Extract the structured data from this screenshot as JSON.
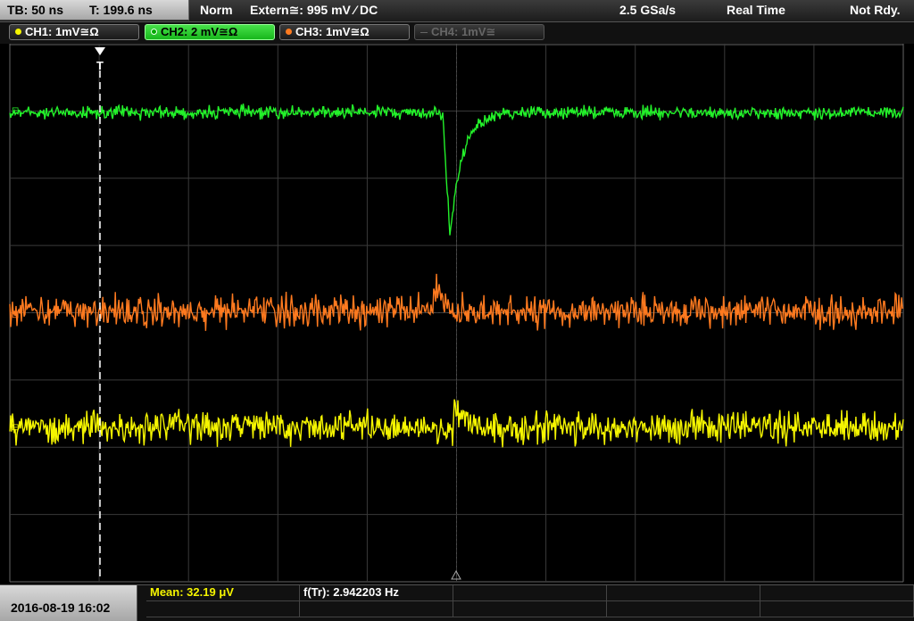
{
  "topbar": {
    "timebase": "TB: 50 ns",
    "trigger_pos": "T: 199.6 ns",
    "mode": "Norm",
    "trigger_source": "Extern≅: 995 mV ⁄ DC",
    "sample_rate": "2.5 GSa/s",
    "acq_mode": "Real Time",
    "status": "Not Rdy."
  },
  "channels": [
    {
      "id": "ch1",
      "label": "CH1: 1mV≅Ω",
      "color": "#f5f500",
      "active": false,
      "enabled": true
    },
    {
      "id": "ch2",
      "label": "CH2: 2 mV≅Ω",
      "color": "#23f22a",
      "active": true,
      "enabled": true
    },
    {
      "id": "ch3",
      "label": "CH3: 1mV≅Ω",
      "color": "#ff7a1f",
      "active": false,
      "enabled": true
    },
    {
      "id": "ch4",
      "label": "CH4: 1mV≅",
      "color": "#666666",
      "active": false,
      "enabled": false
    }
  ],
  "trigger_marker": "T",
  "measurements": {
    "mean": "Mean: 32.19 μV",
    "freq": "f(Tr): 2.942203 Hz"
  },
  "datetime": "2016-08-19 16:02",
  "colors": {
    "ch1": "#f5f500",
    "ch2": "#23f22a",
    "ch3": "#ff7a1f",
    "grid": "#3a3a3a",
    "dashed_grid": "#333333",
    "mean_text": "#f5f500"
  }
}
